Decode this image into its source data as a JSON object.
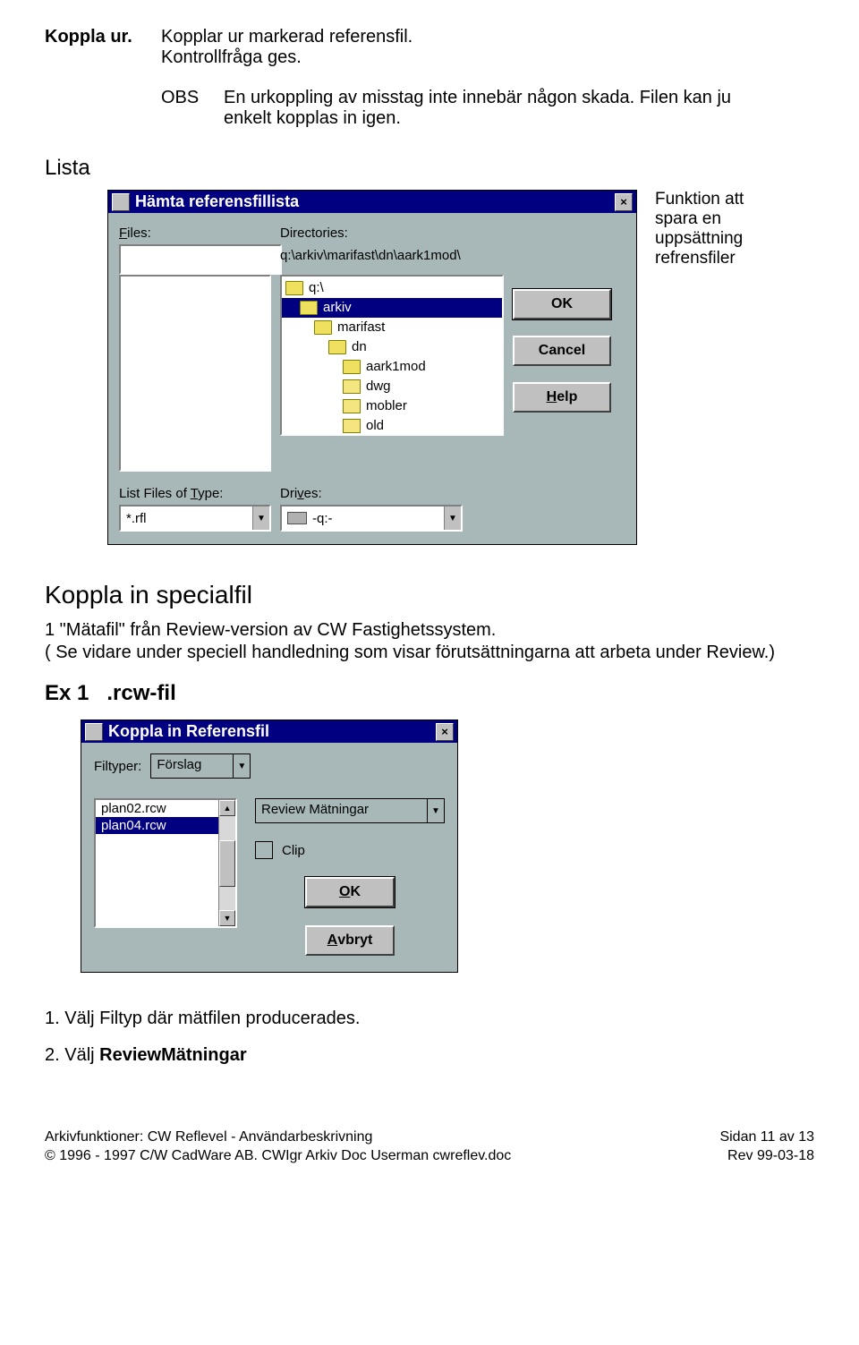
{
  "kopplaUr": {
    "label": "Koppla ur.",
    "desc1": "Kopplar ur markerad referensfil.",
    "desc2": "Kontrollfråga ges.",
    "obsLabel": "OBS",
    "obsText": "En urkoppling av misstag inte innebär någon skada. Filen kan ju enkelt kopplas in igen."
  },
  "lista": {
    "heading": "Lista",
    "caption": "Funktion att spara en uppsättning refrensfiler"
  },
  "dialog1": {
    "title": "Hämta referensfillista",
    "filesLabel": "Files:",
    "dirLabel": "Directories:",
    "pathText": "q:\\arkiv\\marifast\\dn\\aark1mod\\",
    "typeLabel": "List Files of Type:",
    "typeValue": "*.rfl",
    "drivesLabel": "Drives:",
    "drivesValue": "-q:-",
    "ok": "OK",
    "cancel": "Cancel",
    "help": "Help",
    "dirTree": [
      {
        "name": "q:\\",
        "indent": 0,
        "open": true,
        "selected": false
      },
      {
        "name": "arkiv",
        "indent": 1,
        "open": true,
        "selected": true
      },
      {
        "name": "marifast",
        "indent": 2,
        "open": true,
        "selected": false
      },
      {
        "name": "dn",
        "indent": 3,
        "open": true,
        "selected": false
      },
      {
        "name": "aark1mod",
        "indent": 4,
        "open": true,
        "selected": false
      },
      {
        "name": "dwg",
        "indent": 4,
        "open": false,
        "selected": false
      },
      {
        "name": "mobler",
        "indent": 4,
        "open": false,
        "selected": false
      },
      {
        "name": "old",
        "indent": 4,
        "open": false,
        "selected": false
      }
    ]
  },
  "kopplaIn": {
    "heading": "Koppla in specialfil",
    "para1": "1 \"Mätafil\" från Review-version av CW Fastighetssystem.",
    "para2": "( Se vidare under speciell handledning som visar förutsättningarna att arbeta under Review.)"
  },
  "ex1": {
    "label": "Ex 1",
    "title": ".rcw-fil"
  },
  "dialog2": {
    "title": "Koppla in Referensfil",
    "filtyperLabel": "Filtyper:",
    "filtyperValue": "Förslag",
    "reviewValue": "Review Mätningar",
    "clipLabel": "Clip",
    "ok": "OK",
    "cancel": "Avbryt",
    "files": [
      {
        "name": "plan02.rcw",
        "selected": false
      },
      {
        "name": "plan04.rcw",
        "selected": true
      }
    ]
  },
  "steps": {
    "s1": "1. Välj Filtyp där mätfilen producerades.",
    "s2a": "2. Välj ",
    "s2b": "ReviewMätningar"
  },
  "footer": {
    "left1": "Arkivfunktioner: CW Reflevel - Användarbeskrivning",
    "left2": "© 1996 - 1997 C/W CadWare AB. CWIgr Arkiv Doc Userman cwreflev.doc",
    "right1": "Sidan 11 av 13",
    "right2": "Rev 99-03-18"
  }
}
